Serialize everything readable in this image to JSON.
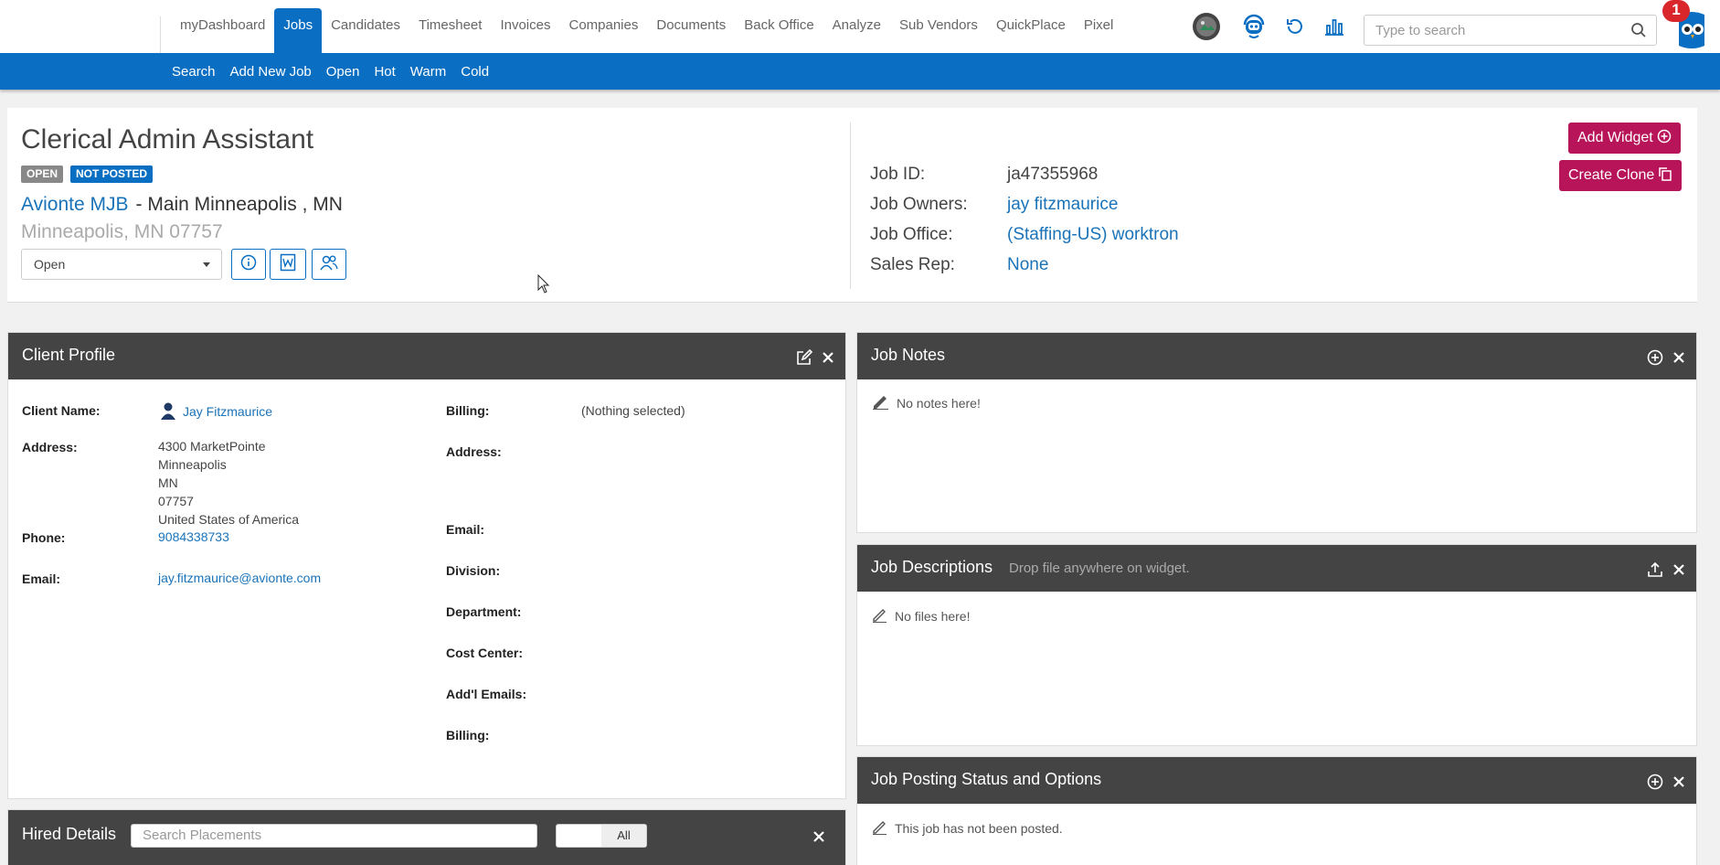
{
  "topnav": {
    "items": [
      "myDashboard",
      "Jobs",
      "Candidates",
      "Timesheet",
      "Invoices",
      "Companies",
      "Documents",
      "Back Office",
      "Analyze",
      "Sub Vendors",
      "QuickPlace",
      "Pixel"
    ],
    "active": "Jobs",
    "search_placeholder": "Type to search",
    "notification_count": "1",
    "icons": [
      "avatar-icon",
      "robot-icon",
      "refresh-icon",
      "bar-chart-icon",
      "search-icon",
      "owl-icon"
    ]
  },
  "subnav": {
    "items": [
      "Search",
      "Add New Job",
      "Open",
      "Hot",
      "Warm",
      "Cold"
    ]
  },
  "job": {
    "title": "Clerical Admin Assistant",
    "tag_open": "OPEN",
    "tag_not_posted": "NOT POSTED",
    "company": "Avionte MJB",
    "branch": "- Main Minneapolis , MN",
    "location": "Minneapolis, MN 07757",
    "status": "Open",
    "action_icons": [
      "info-icon",
      "word-doc-icon",
      "users-icon"
    ],
    "info": {
      "id_label": "Job ID:",
      "id_value": "ja47355968",
      "owners_label": "Job Owners:",
      "owners_value": "jay fitzmaurice",
      "office_label": "Job Office:",
      "office_value": "(Staffing-US) worktron",
      "sales_label": "Sales Rep:",
      "sales_value": "None"
    },
    "add_widget_label": "Add Widget",
    "create_clone_label": "Create Clone"
  },
  "client_profile": {
    "title": "Client Profile",
    "client_name_label": "Client Name:",
    "client_name": "Jay Fitzmaurice",
    "address_label": "Address:",
    "address_lines": [
      "4300 MarketPointe",
      "Minneapolis",
      "MN",
      "07757",
      "United States of America"
    ],
    "phone_label": "Phone:",
    "phone": "9084338733",
    "email_label": "Email:",
    "email": "jay.fitzmaurice@avionte.com",
    "billing_label": "Billing:",
    "billing_value": "(Nothing selected)",
    "right_labels": [
      "Address:",
      "Email:",
      "Division:",
      "Department:",
      "Cost Center:",
      "Add'l Emails:",
      "Billing:"
    ]
  },
  "job_notes": {
    "title": "Job Notes",
    "empty": "No notes here!"
  },
  "job_descriptions": {
    "title": "Job Descriptions",
    "subtitle": "Drop file anywhere on widget.",
    "empty": "No files here!"
  },
  "job_posting": {
    "title": "Job Posting Status and Options",
    "empty": "This job has not been posted."
  },
  "hired_details": {
    "title": "Hired Details",
    "search_placeholder": "Search Placements",
    "toggle_label": "All"
  },
  "colors": {
    "brand_blue": "#0a6fc2",
    "accent_pink": "#b81459",
    "widget_header": "#444444",
    "link": "#1a73b8"
  }
}
